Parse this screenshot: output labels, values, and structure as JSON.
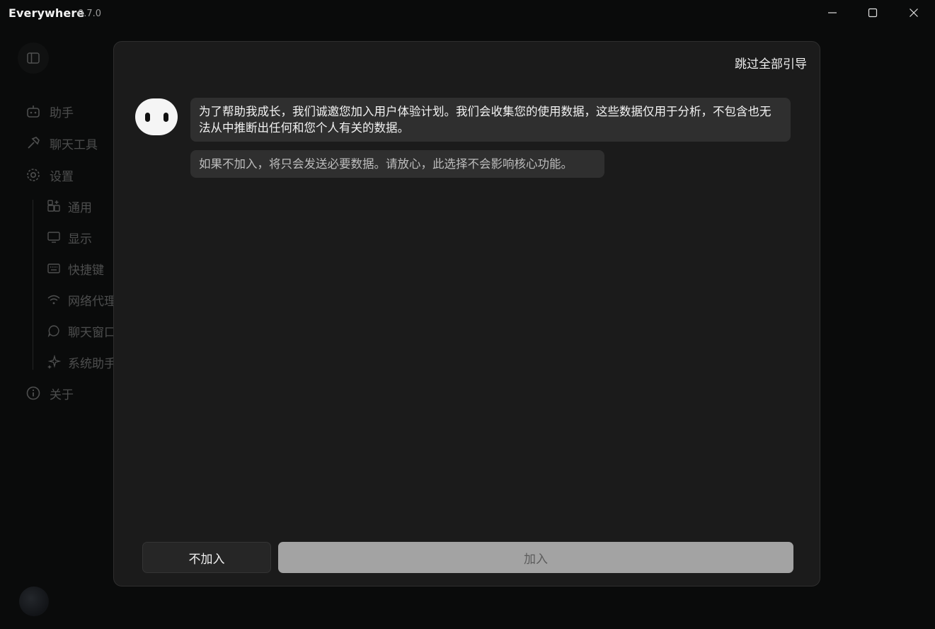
{
  "window": {
    "title": "Everywhere",
    "version": "0.7.0"
  },
  "sidebar": {
    "items": [
      {
        "label": "助手",
        "icon": "robot-icon"
      },
      {
        "label": "聊天工具",
        "icon": "hammer-icon"
      },
      {
        "label": "设置",
        "icon": "gear-icon"
      }
    ],
    "settings_subitems": [
      {
        "label": "通用",
        "icon": "grid-plus-icon"
      },
      {
        "label": "显示",
        "icon": "monitor-icon"
      },
      {
        "label": "快捷键",
        "icon": "keyboard-icon"
      },
      {
        "label": "网络代理",
        "icon": "wifi-icon"
      },
      {
        "label": "聊天窗口",
        "icon": "chat-bubble-icon"
      },
      {
        "label": "系统助手",
        "icon": "sparkle-icon"
      }
    ],
    "about": {
      "label": "关于",
      "icon": "info-icon"
    }
  },
  "dialog": {
    "skip_label": "跳过全部引导",
    "message_primary": "为了帮助我成长，我们诚邀您加入用户体验计划。我们会收集您的使用数据，这些数据仅用于分析，不包含也无法从中推断出任何和您个人有关的数据。",
    "message_secondary": "如果不加入，将只会发送必要数据。请放心，此选择不会影响核心功能。",
    "decline_label": "不加入",
    "join_label": "加入"
  }
}
